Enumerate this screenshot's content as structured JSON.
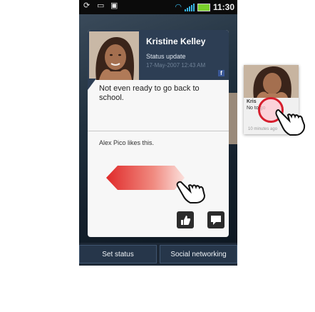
{
  "status_bar": {
    "time": "11:30"
  },
  "card": {
    "name": "Kristine Kelley",
    "post_type": "Status update",
    "date": "17-May-2007 12:43 AM",
    "network_badge": "f",
    "message": "Not even ready to go back to school.",
    "likes": "Alex Pico likes this."
  },
  "bottom_tabs": {
    "set_status": "Set status",
    "social": "Social networking"
  },
  "mini_widget": {
    "name": "Kris",
    "text": "No      to go",
    "time": "10 minutes ago"
  },
  "colors": {
    "card_header": "#2d3e54",
    "swipe_arrow": "#e02a2a",
    "tap_ring": "#d61f2e"
  }
}
